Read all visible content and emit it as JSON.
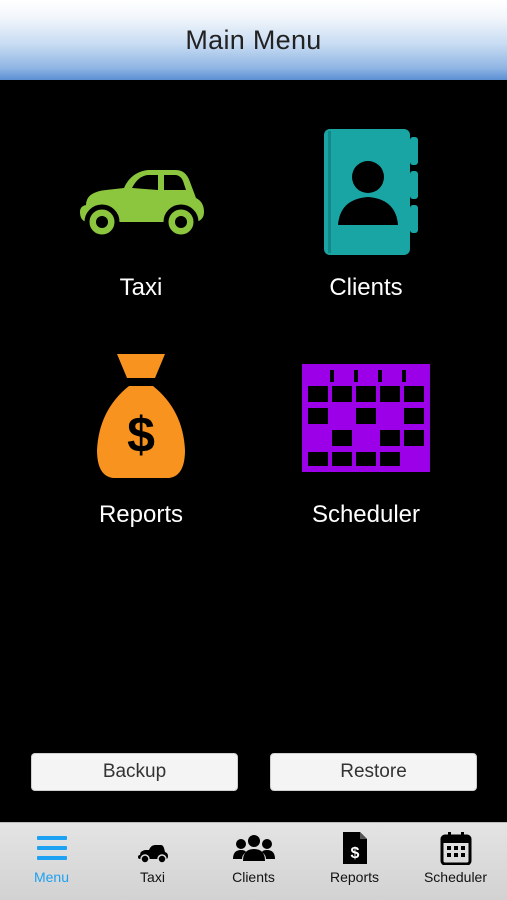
{
  "header": {
    "title": "Main Menu"
  },
  "tiles": [
    {
      "label": "Taxi",
      "icon": "taxi-car-icon",
      "color": "#8cc63f"
    },
    {
      "label": "Clients",
      "icon": "address-book-icon",
      "color": "#1aa5a5"
    },
    {
      "label": "Reports",
      "icon": "money-bag-icon",
      "color": "#f7931e"
    },
    {
      "label": "Scheduler",
      "icon": "calendar-grid-icon",
      "color": "#9b00e8"
    }
  ],
  "actions": {
    "backup_label": "Backup",
    "restore_label": "Restore"
  },
  "tabbar": {
    "tabs": [
      {
        "label": "Menu",
        "icon": "hamburger-menu-icon",
        "active": true
      },
      {
        "label": "Taxi",
        "icon": "car-icon",
        "active": false
      },
      {
        "label": "Clients",
        "icon": "people-icon",
        "active": false
      },
      {
        "label": "Reports",
        "icon": "report-document-icon",
        "active": false
      },
      {
        "label": "Scheduler",
        "icon": "calendar-icon",
        "active": false
      }
    ],
    "active_color": "#1da1f2"
  }
}
